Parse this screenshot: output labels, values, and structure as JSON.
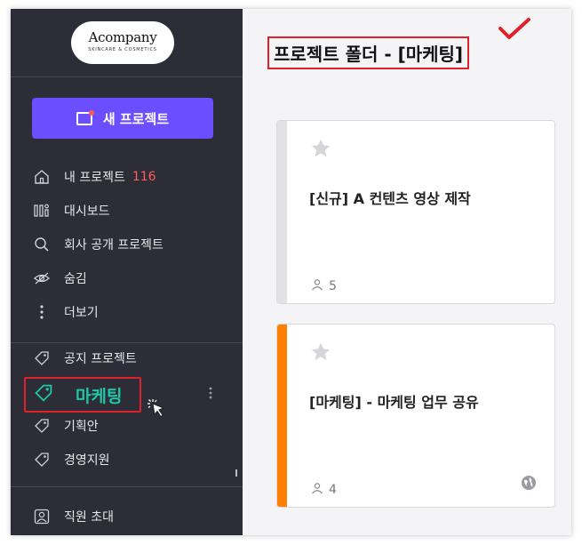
{
  "logo": {
    "brand": "Acompany",
    "tagline": "SKINCARE & COSMETICS"
  },
  "new_project_button": {
    "label": "새 프로젝트"
  },
  "nav": {
    "my_projects": {
      "label": "내 프로젝트",
      "count": "116"
    },
    "dashboard": {
      "label": "대시보드"
    },
    "public_projects": {
      "label": "회사 공개 프로젝트"
    },
    "hidden": {
      "label": "숨김"
    },
    "more": {
      "label": "더보기"
    }
  },
  "folders": {
    "notice": {
      "label": "공지 프로젝트"
    },
    "marketing": {
      "label": "마케팅"
    },
    "planning": {
      "label": "기획안"
    },
    "management": {
      "label": "경영지원"
    }
  },
  "invite": {
    "label": "직원 초대"
  },
  "main": {
    "title": "프로젝트 폴더 - [마케팅]",
    "cards": [
      {
        "title": "[신규] A 컨텐츠 영상 제작",
        "members": "5",
        "bar_color": "#e2e2e6"
      },
      {
        "title": "[마케팅] - 마케팅 업무 공유",
        "members": "4",
        "bar_color": "#ff7f00"
      }
    ]
  },
  "colors": {
    "sidebar_bg": "#2d2d38",
    "accent_purple": "#6b4eff",
    "highlight_red": "#e0202a",
    "active_teal": "#20c7a7",
    "count_red": "#ff5c5c"
  },
  "icons": {
    "home": "home-icon",
    "dashboard": "dashboard-icon",
    "search": "search-icon",
    "eye": "eye-off-icon",
    "more": "more-vertical-icon",
    "tag": "tag-icon",
    "invite": "invite-icon",
    "star": "star-icon",
    "user": "user-icon",
    "globe": "globe-icon",
    "check": "check-icon",
    "cursor": "cursor-icon"
  }
}
